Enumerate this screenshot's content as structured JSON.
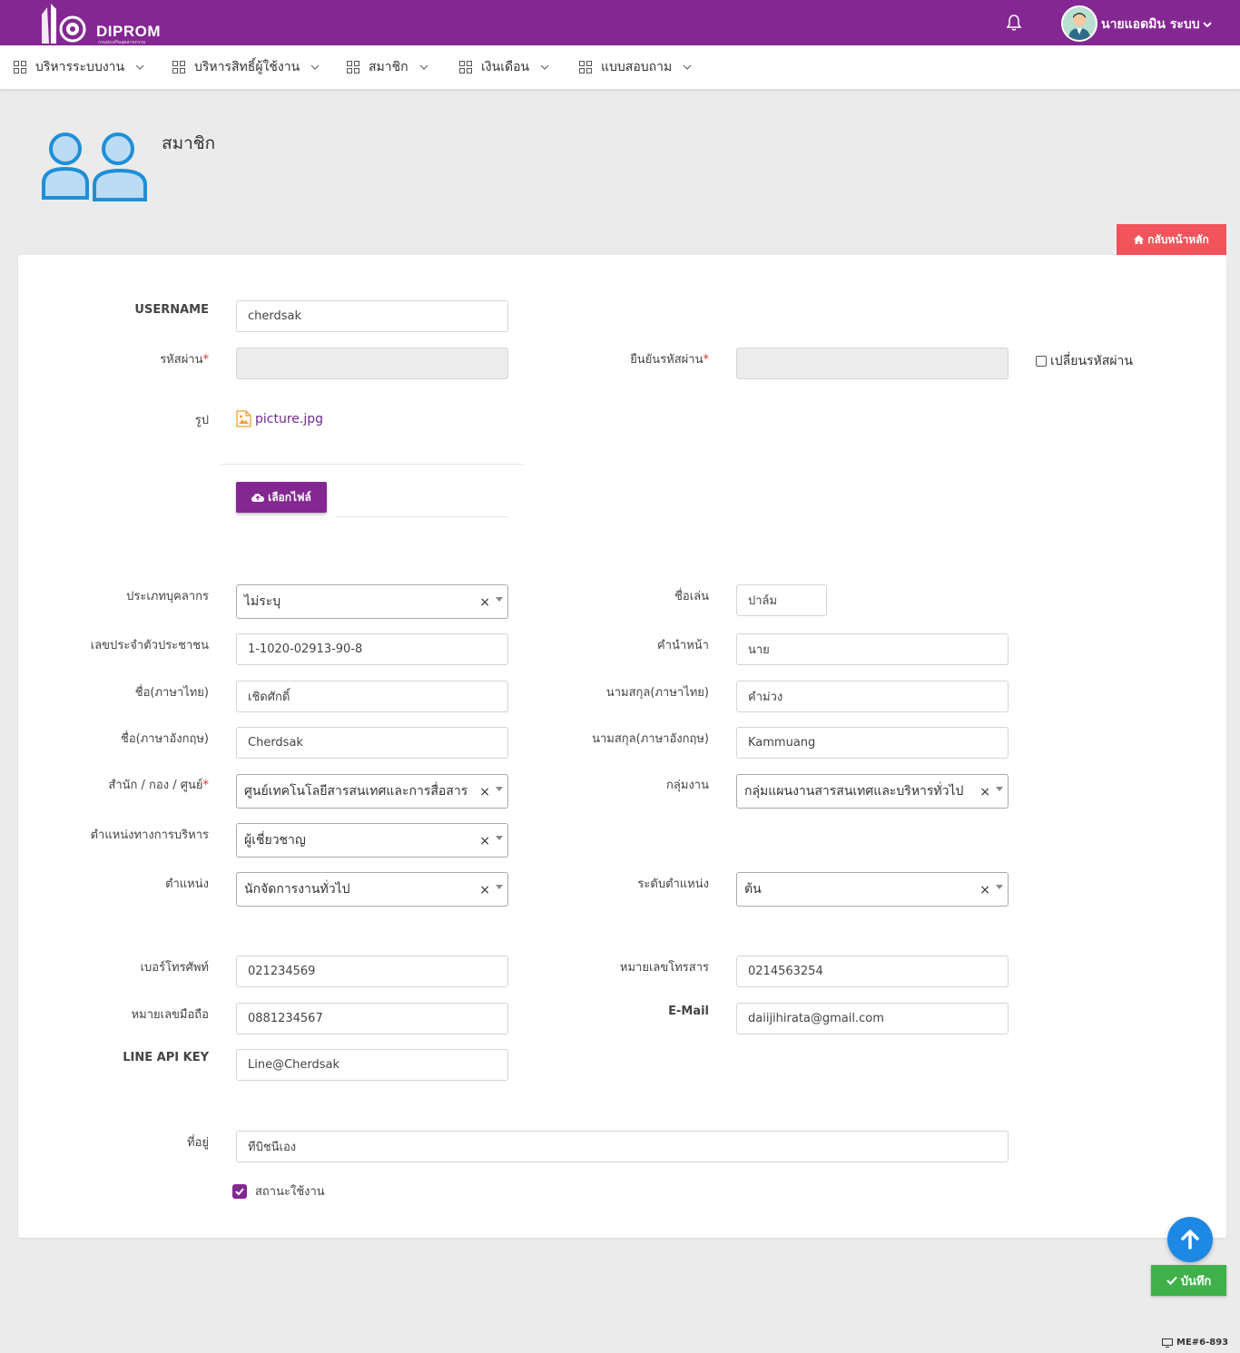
{
  "header": {
    "logo_text": "DIPROM",
    "logo_subtext": "กรมส่งเสริมอุตสาหกรรม",
    "user_name": "นายแอดมิน ระบบ"
  },
  "menu": [
    {
      "label": "บริหารระบบงาน"
    },
    {
      "label": "บริหารสิทธิ์ผู้ใช้งาน"
    },
    {
      "label": "สมาชิก"
    },
    {
      "label": "เงินเดือน"
    },
    {
      "label": "แบบสอบถาม"
    }
  ],
  "page": {
    "title": "สมาชิก",
    "back_label": "กลับหน้าหลัก"
  },
  "form": {
    "username_label": "USERNAME",
    "username_value": "cherdsak",
    "password_label": "รหัสผ่าน",
    "confirm_password_label": "ยืนยันรหัสผ่าน",
    "change_password_label": "เปลี่ยนรหัสผ่าน",
    "picture_label": "รูป",
    "picture_file": "picture.jpg",
    "choose_file_label": "เลือกไฟล์",
    "personnel_type_label": "ประเภทบุคลากร",
    "personnel_type_value": "ไม่ระบุ",
    "nickname_label": "ชื่อเล่น",
    "nickname_value": "ปาล์ม",
    "id_card_label": "เลขประจำตัวประชาชน",
    "id_card_value": "1-1020-02913-90-8",
    "prefix_label": "คำนำหน้า",
    "prefix_value": "นาย",
    "firstname_th_label": "ชื่อ(ภาษาไทย)",
    "firstname_th_value": "เชิดศักดิ์",
    "lastname_th_label": "นามสกุล(ภาษาไทย)",
    "lastname_th_value": "คำม่วง",
    "firstname_en_label": "ชื่อ(ภาษาอังกฤษ)",
    "firstname_en_value": "Cherdsak",
    "lastname_en_label": "นามสกุล(ภาษาอังกฤษ)",
    "lastname_en_value": "Kammuang",
    "office_label": "สำนัก / กอง / ศูนย์",
    "office_value": "ศูนย์เทคโนโลยีสารสนเทศและการสื่อสาร",
    "workgroup_label": "กลุ่มงาน",
    "workgroup_value": "กลุ่มแผนงานสารสนเทศและบริหารทั่วไป",
    "admin_position_label": "ตำแหน่งทางการบริหาร",
    "admin_position_value": "ผู้เชี่ยวชาญ",
    "position_label": "ตำแหน่ง",
    "position_value": "นักจัดการงานทั่วไป",
    "position_level_label": "ระดับตำแหน่ง",
    "position_level_value": "ต้น",
    "phone_label": "เบอร์โทรศัพท์",
    "phone_value": "021234569",
    "fax_label": "หมายเลขโทรสาร",
    "fax_value": "0214563254",
    "mobile_label": "หมายเลขมือถือ",
    "mobile_value": "0881234567",
    "email_label": "E-Mail",
    "email_value": "daiijihirata@gmail.com",
    "line_label": "LINE API KEY",
    "line_value": "Line@Cherdsak",
    "address_label": "ที่อยู่",
    "address_value": "ทีบิชนีเอง",
    "status_label": "สถานะใช้งาน"
  },
  "actions": {
    "save_label": "บันทึก"
  },
  "footer": {
    "code": "ME#6-893"
  },
  "colors": {
    "brand_purple": "#842792",
    "back_button": "#f2545b",
    "save_button": "#3fb04a",
    "scroll_top": "#1e88e5"
  }
}
